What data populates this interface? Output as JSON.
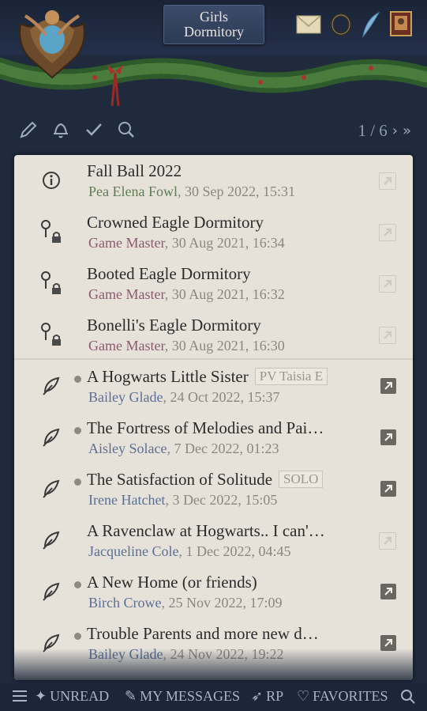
{
  "header": {
    "title_line1": "Girls",
    "title_line2": "Dormitory",
    "icons": [
      "house-crest-icon",
      "envelope-icon",
      "ring-icon",
      "quill-icon",
      "spellbook-icon"
    ]
  },
  "toolbar": {
    "icons": [
      "pencil-icon",
      "bell-icon",
      "check-icon",
      "search-icon"
    ],
    "page": "1 / 6"
  },
  "topics": [
    {
      "icon": "info-icon",
      "title": "Fall Ball 2022",
      "author": "Pea Elena Fowl",
      "date": ", 30 Sep 2022, 15:31",
      "author_color": "#5f7d55",
      "unread": false,
      "tag": "",
      "link": "dim"
    },
    {
      "icon": "locked-pin-icon",
      "title": "Crowned Eagle Dormitory",
      "author": "Game Master",
      "date": ", 30 Aug 2021, 16:34",
      "author_color": "#8a5a6e",
      "unread": false,
      "tag": "",
      "link": "dim"
    },
    {
      "icon": "locked-pin-icon",
      "title": "Booted Eagle Dormitory",
      "author": "Game Master",
      "date": ", 30 Aug 2021, 16:32",
      "author_color": "#8a5a6e",
      "unread": false,
      "tag": "",
      "link": "dim"
    },
    {
      "icon": "locked-pin-icon",
      "title": "Bonelli's Eagle Dormitory",
      "author": "Game Master",
      "date": ", 30 Aug 2021, 16:30",
      "author_color": "#8a5a6e",
      "unread": false,
      "tag": "",
      "link": "dim"
    },
    {
      "icon": "feather-icon",
      "title": "A Hogwarts Little Sister",
      "author": "Bailey Glade",
      "date": ", 24 Oct 2022, 15:37",
      "author_color": "#5b6f93",
      "unread": true,
      "tag": "PV Taisia E",
      "link": "solid"
    },
    {
      "icon": "feather-icon",
      "title": "The Fortress of Melodies and Pai…",
      "author": "Aisley Solace",
      "date": ", 7 Dec 2022, 01:23",
      "author_color": "#5b6f93",
      "unread": true,
      "tag": "",
      "link": "solid"
    },
    {
      "icon": "feather-icon",
      "title": "The Satisfaction of Solitude",
      "author": "Irene Hatchet",
      "date": ", 3 Dec 2022, 15:05",
      "author_color": "#5b6f93",
      "unread": true,
      "tag": "SOLO",
      "link": "solid"
    },
    {
      "icon": "feather-icon",
      "title": "A Ravenclaw at Hogwarts.. I can'…",
      "author": "Jacqueline Cole",
      "date": ", 1 Dec 2022, 04:45",
      "author_color": "#5b6f93",
      "unread": false,
      "tag": "",
      "link": "dim"
    },
    {
      "icon": "feather-icon",
      "title": "A New Home (or friends)",
      "author": "Birch Crowe",
      "date": ", 25 Nov 2022, 17:09",
      "author_color": "#5b6f93",
      "unread": true,
      "tag": "",
      "link": "solid"
    },
    {
      "icon": "feather-icon",
      "title": "Trouble Parents and more new d…",
      "author": "Bailey Glade",
      "date": ", 24 Nov 2022, 19:22",
      "author_color": "#5b6f93",
      "unread": true,
      "tag": "",
      "link": "solid"
    }
  ],
  "bottom_nav": {
    "unread": "UNREAD",
    "my_messages": "MY MESSAGES",
    "rp": "RP",
    "favorites": "FAVORITES"
  },
  "colors": {
    "background": "#1f2a3d",
    "panel": "#e6e2da",
    "nav_text": "#a9b3c7"
  }
}
